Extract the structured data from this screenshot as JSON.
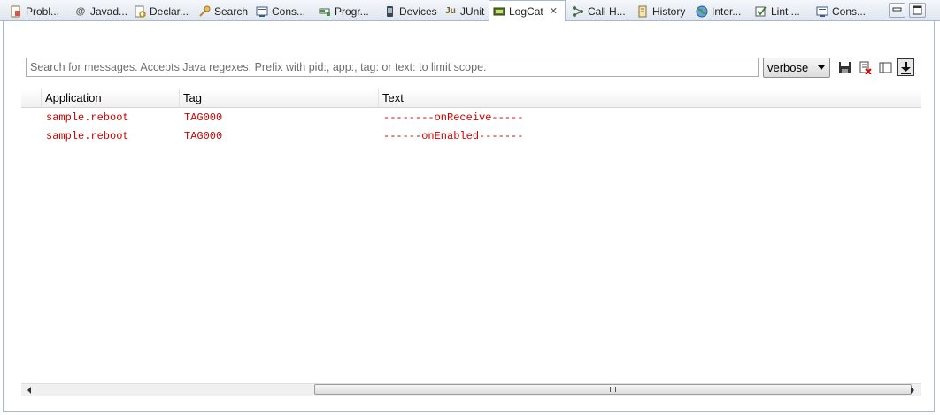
{
  "tabs": [
    {
      "label": "Probl...",
      "icon": "problems-icon",
      "active": false
    },
    {
      "label": "Javad...",
      "icon": "javadoc-icon",
      "active": false
    },
    {
      "label": "Declar...",
      "icon": "declaration-icon",
      "active": false
    },
    {
      "label": "Search",
      "icon": "search-icon",
      "active": false
    },
    {
      "label": "Cons...",
      "icon": "console-icon",
      "active": false
    },
    {
      "label": "Progr...",
      "icon": "progress-icon",
      "active": false
    },
    {
      "label": "Devices",
      "icon": "device-icon",
      "active": false
    },
    {
      "label": "JUnit",
      "icon": "junit-icon",
      "active": false
    },
    {
      "label": "LogCat",
      "icon": "logcat-icon",
      "active": true
    },
    {
      "label": "Call H...",
      "icon": "call-hierarchy-icon",
      "active": false
    },
    {
      "label": "History",
      "icon": "history-icon",
      "active": false
    },
    {
      "label": "Inter...",
      "icon": "globe-icon",
      "active": false
    },
    {
      "label": "Lint ...",
      "icon": "lint-icon",
      "active": false
    },
    {
      "label": "Cons...",
      "icon": "console-icon",
      "active": false
    }
  ],
  "search": {
    "placeholder": "Search for messages. Accepts Java regexes. Prefix with pid:, app:, tag: or text: to limit scope.",
    "value": ""
  },
  "log_level": {
    "selected": "verbose"
  },
  "toolbar_icons": [
    "save-log-icon",
    "clear-log-icon",
    "toggle-filters-icon",
    "scroll-lock-icon"
  ],
  "table": {
    "columns": [
      "Application",
      "Tag",
      "Text"
    ],
    "rows": [
      {
        "application": "sample.reboot",
        "tag": "TAG000",
        "text": "--------onReceive-----"
      },
      {
        "application": "sample.reboot",
        "tag": "TAG000",
        "text": "------onEnabled-------"
      }
    ]
  },
  "colors": {
    "log_text": "#d00000",
    "tab_border": "#a9b8cf"
  }
}
